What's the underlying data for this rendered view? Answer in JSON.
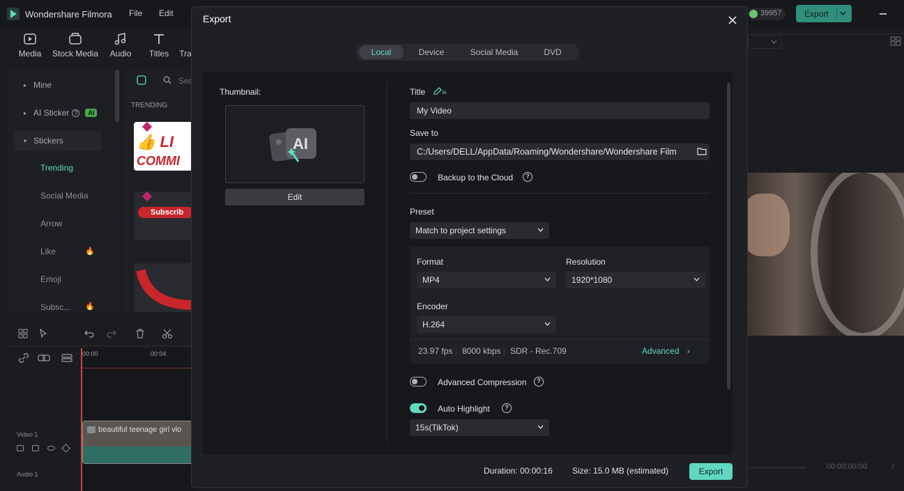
{
  "app": {
    "name": "Wondershare Filmora",
    "menu": [
      "File",
      "Edit"
    ],
    "credits": "39957",
    "export_label": "Export",
    "toolbar": [
      "Media",
      "Stock Media",
      "Audio",
      "Titles",
      "Tra"
    ],
    "left_panel": {
      "groups": [
        "Mine",
        "AI Sticker",
        "Stickers"
      ],
      "ai_badge": "AI",
      "subitems": [
        "Trending",
        "Social Media",
        "Arrow",
        "Like",
        "Emoji",
        "Subsc..."
      ]
    },
    "mid_panel": {
      "search_placeholder": "Sea",
      "section": "TRENDING"
    },
    "timeline": {
      "times": [
        "00:00",
        "00:04"
      ],
      "clip_name": "beautiful teenage girl vlo",
      "track_video": "Video 1",
      "track_audio": "Audio 1"
    },
    "preview": {
      "timecode": "00:00:00:00",
      "slash": "/"
    }
  },
  "dialog": {
    "title": "Export",
    "tabs": [
      {
        "label": "Local",
        "active": true
      },
      {
        "label": "Device",
        "active": false
      },
      {
        "label": "Social Media",
        "active": false
      },
      {
        "label": "DVD",
        "active": false
      }
    ],
    "thumbnail_label": "Thumbnail:",
    "edit_label": "Edit",
    "title_label": "Title",
    "title_value": "My Video",
    "save_to_label": "Save to",
    "save_to_value": "C:/Users/DELL/AppData/Roaming/Wondershare/Wondershare Film",
    "backup_label": "Backup to the Cloud",
    "preset_label": "Preset",
    "preset_value": "Match to project settings",
    "format_label": "Format",
    "format_value": "MP4",
    "resolution_label": "Resolution",
    "resolution_value": "1920*1080",
    "encoder_label": "Encoder",
    "encoder_value": "H.264",
    "specs": [
      "23.97 fps",
      "8000 kbps",
      "SDR - Rec.709"
    ],
    "advanced_label": "Advanced",
    "adv_compression_label": "Advanced Compression",
    "auto_highlight_label": "Auto Highlight",
    "auto_highlight_value": "15s(TikTok)",
    "duration_text": "Duration:  00:00:16",
    "size_text": "Size:  15.0 MB (estimated)",
    "export_label": "Export",
    "ai_thumb_text": "AI",
    "ai_tag": "AI"
  },
  "colors": {
    "accent": "#5fd8bf",
    "dialog_bg": "#1f2024",
    "content_bg": "#17181b"
  }
}
